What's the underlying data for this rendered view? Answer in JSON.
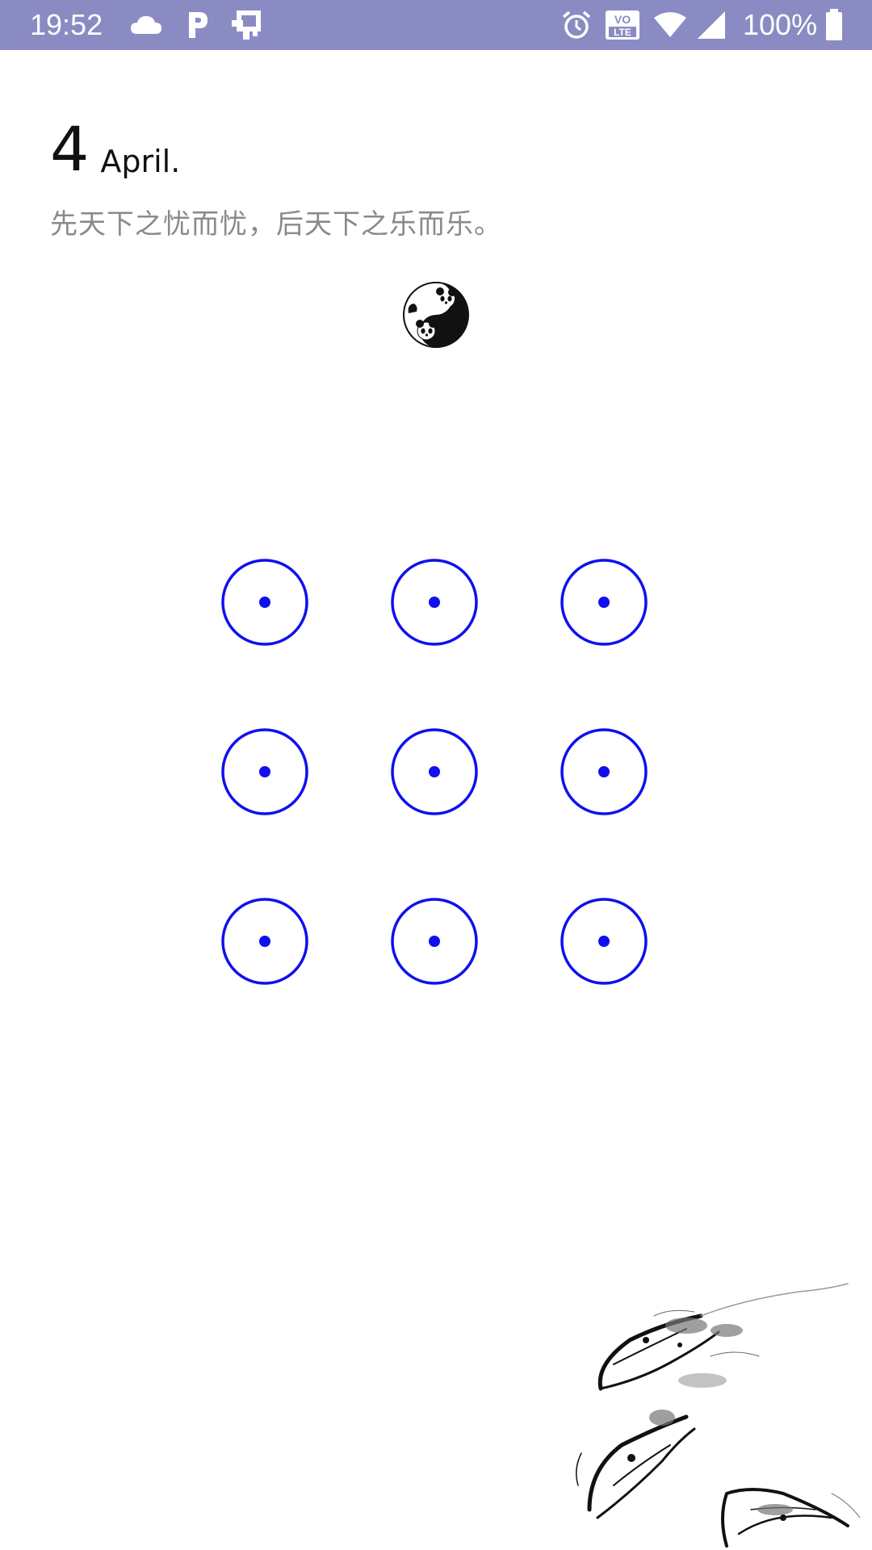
{
  "status_bar": {
    "time": "19:52",
    "battery_percent": "100%",
    "left_icons": [
      "cloud-icon",
      "parking-icon",
      "notification-app-icon"
    ],
    "right_icons": [
      "alarm-icon",
      "volte-icon",
      "wifi-icon",
      "signal-icon",
      "battery-icon"
    ],
    "volte_label": "VO\nLTE",
    "background_color": "#8b8bc4"
  },
  "lock_screen": {
    "date_day": "4",
    "date_month": "April.",
    "quote": "先天下之忧而忧，后天下之乐而乐。"
  },
  "pattern_lock": {
    "rows": 3,
    "columns": 3,
    "dot_color": "#1010ee"
  }
}
